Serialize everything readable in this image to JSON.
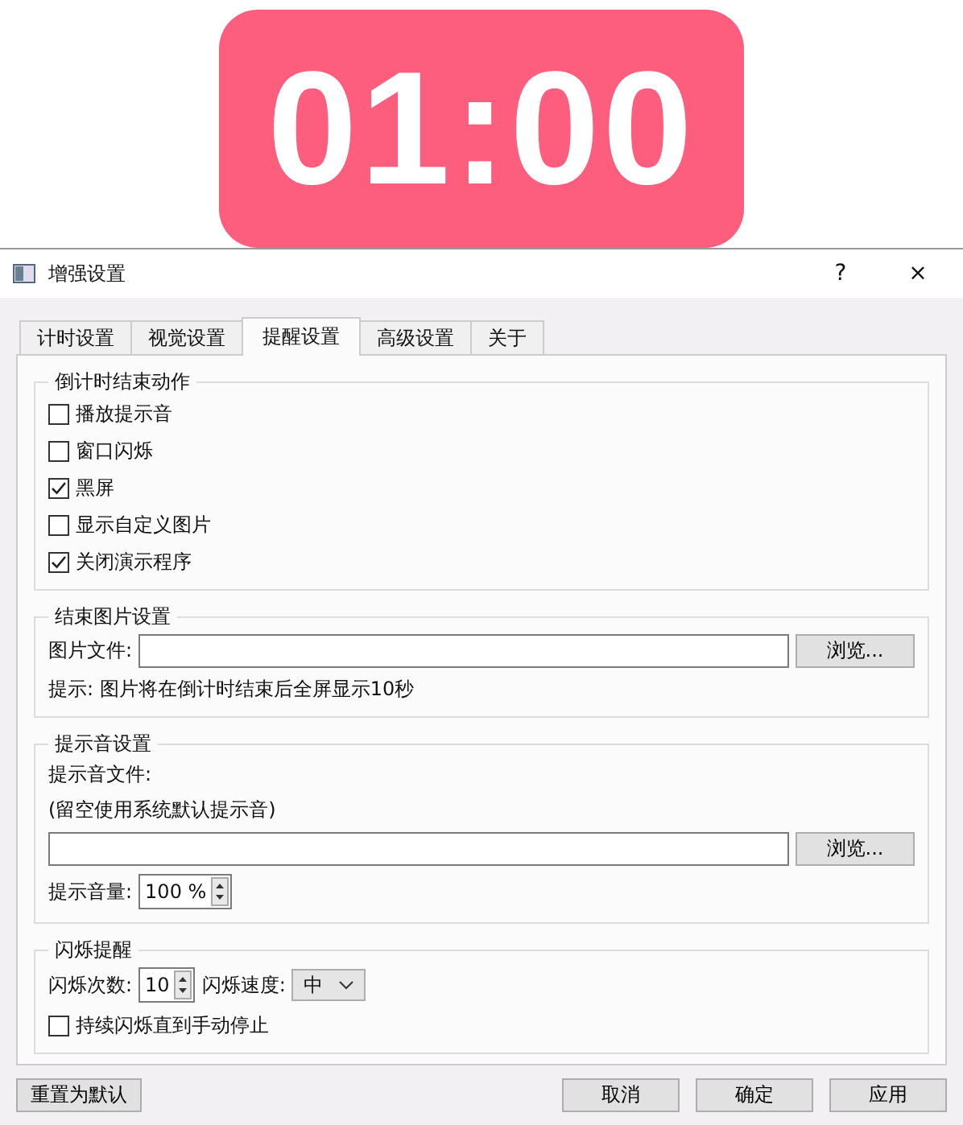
{
  "timer": {
    "display": "01:00"
  },
  "window": {
    "title": "增强设置",
    "help": "?",
    "close": "×"
  },
  "tabs": [
    {
      "label": "计时设置",
      "selected": false
    },
    {
      "label": "视觉设置",
      "selected": false
    },
    {
      "label": "提醒设置",
      "selected": true
    },
    {
      "label": "高级设置",
      "selected": false
    },
    {
      "label": "关于",
      "selected": false
    }
  ],
  "end_actions": {
    "title": "倒计时结束动作",
    "options": [
      {
        "label": "播放提示音",
        "checked": false
      },
      {
        "label": "窗口闪烁",
        "checked": false
      },
      {
        "label": "黑屏",
        "checked": true
      },
      {
        "label": "显示自定义图片",
        "checked": false
      },
      {
        "label": "关闭演示程序",
        "checked": true
      }
    ]
  },
  "image_settings": {
    "title": "结束图片设置",
    "file_label": "图片文件:",
    "browse": "浏览...",
    "hint": "提示: 图片将在倒计时结束后全屏显示10秒"
  },
  "sound_settings": {
    "title": "提示音设置",
    "file_label": "提示音文件:",
    "file_note": "(留空使用系统默认提示音)",
    "browse": "浏览...",
    "volume_label": "提示音量:",
    "volume": "100 %"
  },
  "flash": {
    "title": "闪烁提醒",
    "count_label": "闪烁次数:",
    "count": "10",
    "speed_label": "闪烁速度:",
    "speed": "中",
    "continuous": {
      "label": "持续闪烁直到手动停止",
      "checked": false
    }
  },
  "buttons": {
    "reset": "重置为默认",
    "cancel": "取消",
    "ok": "确定",
    "apply": "应用"
  }
}
